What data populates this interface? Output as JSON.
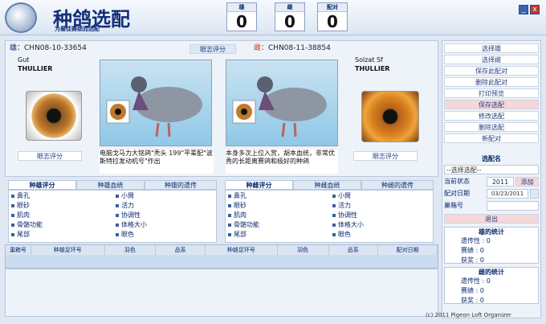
{
  "app": {
    "title": "种鸽选配",
    "subtitle": "为最佳赛绩而选配"
  },
  "counters": [
    {
      "label": "雄",
      "value": "0"
    },
    {
      "label": "雌",
      "value": "0"
    },
    {
      "label": "配对",
      "value": "0"
    }
  ],
  "window": {
    "minimize": "_",
    "close": "x"
  },
  "male": {
    "ring_prefix": "雄：",
    "ring": "CHN08-10-33654",
    "name": "Gut",
    "strain": "THULLIER",
    "eye_label": "眼志评分",
    "remark": "电脑戈马力大铭鸽\"秃头 199\"平辈配\"波斯特拉发动机号\"作出"
  },
  "female": {
    "ring_prefix": "雌：",
    "ring": "CHN08-11-38854",
    "name": "Solzat Sf",
    "strain": "THULLIER",
    "eye_label": "眼志评分",
    "remark": "本身多次上位入赏，胡本血统，非常优秀的长距离赛鸽和极好的种鸽"
  },
  "center_label": "眼志评分",
  "male_tabs": [
    "种雄评分",
    "种雄血统",
    "种雄的遗传"
  ],
  "female_tabs": [
    "种雌评分",
    "种雌血统",
    "种雌的遗传"
  ],
  "traits_left": [
    "鼻孔",
    "眼砂",
    "肌肉",
    "骨骼功能",
    "尾部"
  ],
  "traits_right": [
    "小臂",
    "活力",
    "协调性",
    "体格大小",
    "眼色"
  ],
  "table_headers": [
    "巢箱号",
    "种雄足环号",
    "羽色",
    "品系",
    "种雌足环号",
    "羽色",
    "品系",
    "配对日期"
  ],
  "side_buttons": [
    "选择雄",
    "选择雌",
    "保存此配对",
    "删除此配对",
    "打印预览",
    "保存选配",
    "修改选配",
    "删除选配",
    "新配对"
  ],
  "pair_name_label": "选配名",
  "pair_select": "--选择选配--",
  "status_label": "当前状态",
  "status_year": "2011",
  "add_label": "添加",
  "date_label": "配对日期",
  "date_value": "03/23/2011",
  "nest_label": "巢箱号",
  "exit_label": "退出",
  "male_stats": {
    "title": "雄的统计",
    "items": [
      "遗传性",
      "赛绩",
      "获奖"
    ],
    "values": [
      "0",
      "0",
      "0"
    ]
  },
  "female_stats": {
    "title": "雌的统计",
    "items": [
      "遗传性",
      "赛绩",
      "获奖"
    ],
    "values": [
      "0",
      "0",
      "0"
    ]
  },
  "footer": "(c) 2011 Pigeon Loft Organizer",
  "colors": {
    "accent": "#142f7a",
    "panel": "#eef3fa",
    "danger": "#f7d7d7"
  }
}
